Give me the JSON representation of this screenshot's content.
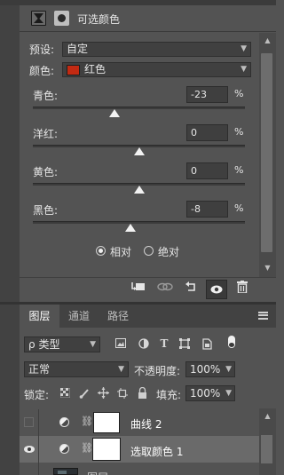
{
  "properties": {
    "header_title": "可选颜色",
    "preset_label": "预设:",
    "preset_value": "自定",
    "colors_label": "颜色:",
    "colors_value": "红色",
    "colors_swatch": "#c22a12",
    "sliders": [
      {
        "label": "青色:",
        "value": "-23",
        "unit": "%",
        "position": -0.23
      },
      {
        "label": "洋红:",
        "value": "0",
        "unit": "%",
        "position": 0
      },
      {
        "label": "黄色:",
        "value": "0",
        "unit": "%",
        "position": 0
      },
      {
        "label": "黑色:",
        "value": "-8",
        "unit": "%",
        "position": -0.08
      }
    ],
    "method": {
      "relative_label": "相对",
      "absolute_label": "绝对",
      "selected": "relative"
    },
    "footer_icons": [
      "clip-to-layer-icon",
      "view-previous-icon",
      "reset-icon",
      "visibility-icon",
      "delete-icon"
    ]
  },
  "layers": {
    "tabs": [
      {
        "label": "图层",
        "active": true
      },
      {
        "label": "通道",
        "active": false
      },
      {
        "label": "路径",
        "active": false
      }
    ],
    "filter_label": "类型",
    "filter_prefix": "ρ",
    "blend_mode": "正常",
    "opacity_label": "不透明度:",
    "opacity_value": "100%",
    "lock_label": "锁定:",
    "fill_label": "填充:",
    "fill_value": "100%",
    "rows": [
      {
        "name": "曲线 2",
        "visible": false,
        "selected": false
      },
      {
        "name": "选取颜色 1",
        "visible": true,
        "selected": true
      },
      {
        "name": "图层",
        "visible": true,
        "selected": false
      }
    ]
  }
}
